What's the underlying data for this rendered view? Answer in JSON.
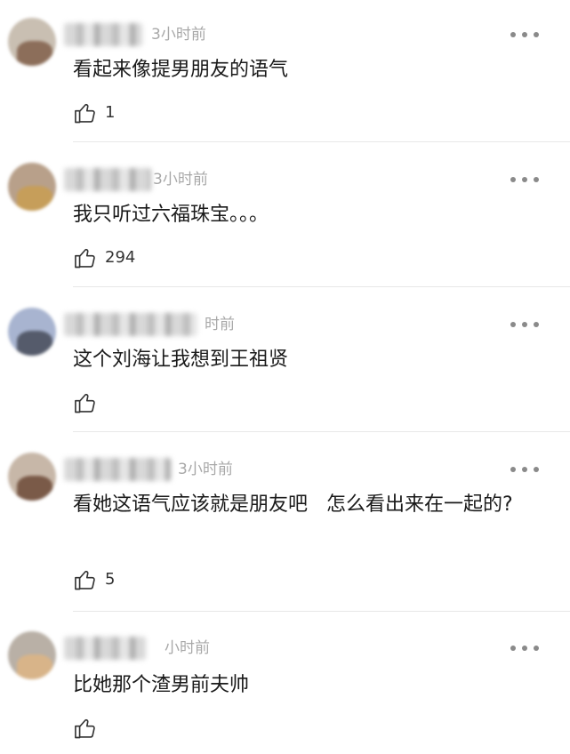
{
  "comments": [
    {
      "time": "3小时前",
      "text": "看起来像提男朋友的语气",
      "likes": "1"
    },
    {
      "time": "3小时前",
      "text": "我只听过六福珠宝。。。",
      "likes": "294"
    },
    {
      "time": "时前",
      "text": "这个刘海让我想到王祖贤",
      "likes": ""
    },
    {
      "time": "3小时前",
      "text": "看她这语气应该就是朋友吧   怎么看出来在一起的?",
      "likes": "5"
    },
    {
      "time": "小时前",
      "text": "比她那个渣男前夫帅",
      "likes": ""
    }
  ],
  "icons": {
    "more": "more-dots-icon",
    "like": "thumbs-up-icon"
  },
  "colors": {
    "text": "#1a1a1a",
    "meta": "#a8a8a8",
    "divider": "#e8e8e8"
  }
}
